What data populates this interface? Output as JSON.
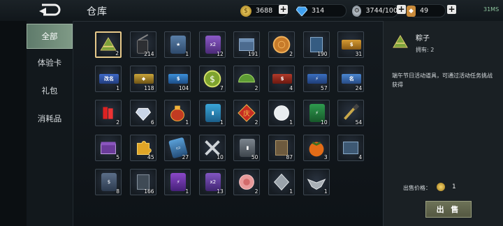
{
  "header": {
    "title": "仓库",
    "gold": "3688",
    "diamond": "314",
    "energy": "3744/100",
    "ticket": "49",
    "signal": "31MS"
  },
  "tabs": [
    {
      "label": "全部",
      "active": true
    },
    {
      "label": "体验卡",
      "active": false
    },
    {
      "label": "礼包",
      "active": false
    },
    {
      "label": "消耗品",
      "active": false
    }
  ],
  "items": [
    {
      "name": "zongzi",
      "count": "2",
      "selected": true
    },
    {
      "name": "walkie-talkie",
      "count": "214"
    },
    {
      "name": "gold-card",
      "count": "1"
    },
    {
      "name": "x2-card-purple",
      "count": "12"
    },
    {
      "name": "crate-blue",
      "count": "191"
    },
    {
      "name": "mooncake",
      "count": "2"
    },
    {
      "name": "book-blue",
      "count": "190"
    },
    {
      "name": "gold-ticket",
      "count": "31"
    },
    {
      "name": "ticket-rename",
      "count": "1"
    },
    {
      "name": "gold-ticket-2",
      "count": "118"
    },
    {
      "name": "blue-ticket",
      "count": "104"
    },
    {
      "name": "coin-green",
      "count": "7"
    },
    {
      "name": "helmet-green",
      "count": "2"
    },
    {
      "name": "red-gold-ticket",
      "count": "4"
    },
    {
      "name": "energy-ticket",
      "count": "57"
    },
    {
      "name": "blue-ticket-2",
      "count": "24"
    },
    {
      "name": "firecracker",
      "count": "2"
    },
    {
      "name": "diamond-badge",
      "count": "6"
    },
    {
      "name": "lucky-bag",
      "count": "1"
    },
    {
      "name": "blue-card",
      "count": "1"
    },
    {
      "name": "red-envelope",
      "count": "2"
    },
    {
      "name": "snowball",
      "count": "1"
    },
    {
      "name": "energy-card-green",
      "count": "10"
    },
    {
      "name": "paintbrush",
      "count": "54"
    },
    {
      "name": "chest-purple",
      "count": "5"
    },
    {
      "name": "puzzle",
      "count": "45"
    },
    {
      "name": "phone-card",
      "count": "27"
    },
    {
      "name": "wrench-tools",
      "count": "10"
    },
    {
      "name": "grey-card",
      "count": "50"
    },
    {
      "name": "book-brown",
      "count": "87"
    },
    {
      "name": "persimmon",
      "count": "3"
    },
    {
      "name": "crate-steel",
      "count": "4"
    },
    {
      "name": "gold-card-2",
      "count": "8"
    },
    {
      "name": "book-dark",
      "count": "166"
    },
    {
      "name": "energy-card-purple",
      "count": "1"
    },
    {
      "name": "x2-card-purple-2",
      "count": "13"
    },
    {
      "name": "rose",
      "count": "2"
    },
    {
      "name": "emblem-silver",
      "count": "1"
    },
    {
      "name": "emblem-wings",
      "count": "1"
    }
  ],
  "detail": {
    "name": "粽子",
    "owned": "拥有: 2",
    "description": "端午节日活动道具，可通过活动任务挑战获得",
    "price_label": "出售价格：",
    "price_value": "1",
    "sell_label": "出 售"
  }
}
